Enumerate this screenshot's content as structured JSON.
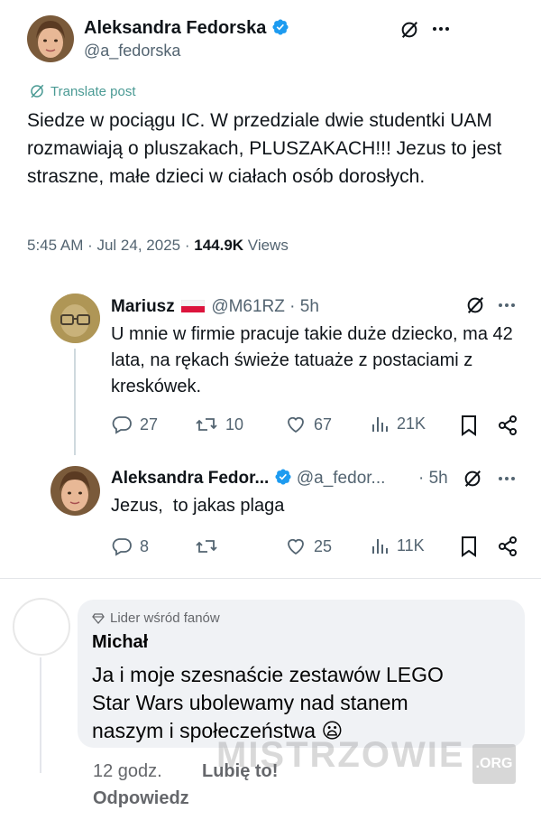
{
  "main_post": {
    "author_name": "Aleksandra Fedorska",
    "handle": "@a_fedorska",
    "translate_label": "Translate post",
    "text": "Siedze w pociągu IC. W przedziale dwie studentki UAM rozmawiają o pluszakach, PLUSZAKACH!!! Jezus to jest straszne, małe dzieci w ciałach osób dorosłych.",
    "time": "5:45 AM · Jul 24, 2025 ·",
    "views_count": "144.9K",
    "views_label": "Views"
  },
  "replies": [
    {
      "author_name": "Mariusz",
      "handle_time": "@M61RZ · 5h",
      "text": "U mnie w firmie pracuje takie duże dziecko, ma 42 lata, na rękach świeże tatuaże z postaciami z kreskówek.",
      "replies_count": "27",
      "reposts_count": "10",
      "likes_count": "67",
      "views_count": "21K"
    },
    {
      "author_name": "Aleksandra Fedor...",
      "handle": "@a_fedor...",
      "time": "· 5h",
      "text": "Jezus,  to jakas plaga",
      "replies_count": "8",
      "reposts_count": "",
      "likes_count": "25",
      "views_count": "11K"
    }
  ],
  "facebook_comment": {
    "badge": "Lider wśród fanów",
    "author": "Michał",
    "text": "Ja i moje szesnaście zestawów LEGO\nStar Wars ubolewamy nad stanem\nnaszym i społeczeństwa 😦",
    "time": "12 godz.",
    "like_label": "Lubię to!",
    "reply_label": "Odpowiedz"
  },
  "watermark": {
    "text": "MISTRZOWIE",
    "suffix": ".ORG"
  },
  "colors": {
    "verified": "#1d9bf0",
    "grey_text": "#536471",
    "bubble": "#f0f2f5"
  }
}
